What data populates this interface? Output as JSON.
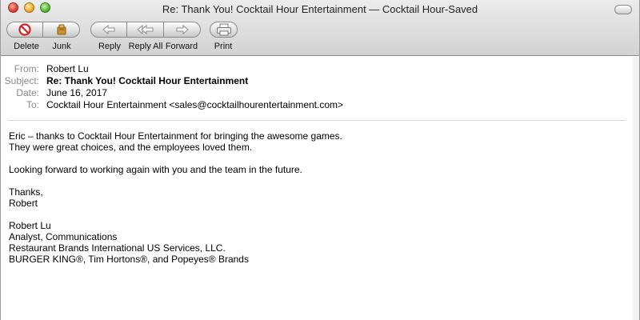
{
  "window": {
    "title": "Re: Thank You! Cocktail Hour Entertainment — Cocktail Hour-Saved"
  },
  "toolbar": {
    "delete_label": "Delete",
    "junk_label": "Junk",
    "reply_label": "Reply",
    "reply_all_label": "Reply All",
    "forward_label": "Forward",
    "print_label": "Print"
  },
  "headers": {
    "from_key": "From:",
    "from_value": "Robert Lu",
    "subject_key": "Subject:",
    "subject_value": "Re: Thank You! Cocktail Hour Entertainment",
    "date_key": "Date:",
    "date_value": "June 16, 2017",
    "to_key": "To:",
    "to_value": "Cocktail Hour Entertainment <sales@cocktailhourentertainment.com>"
  },
  "message": {
    "line1": "Eric – thanks to Cocktail Hour Entertainment for bringing the awesome games.",
    "line2": "They were great choices, and the employees loved them.",
    "line3": "Looking forward to working again with you and the team in the future.",
    "closing": "Thanks,",
    "closing_name": "Robert",
    "sig_name": "Robert Lu",
    "sig_title": "Analyst, Communications",
    "sig_company": "Restaurant Brands International US Services, LLC.",
    "sig_brands": "BURGER KING®, Tim Hortons®, and Popeyes® Brands"
  },
  "icons": {
    "delete": "delete-icon",
    "junk": "junk-icon",
    "reply": "reply-icon",
    "reply_all": "reply-all-icon",
    "forward": "forward-icon",
    "print": "print-icon"
  }
}
